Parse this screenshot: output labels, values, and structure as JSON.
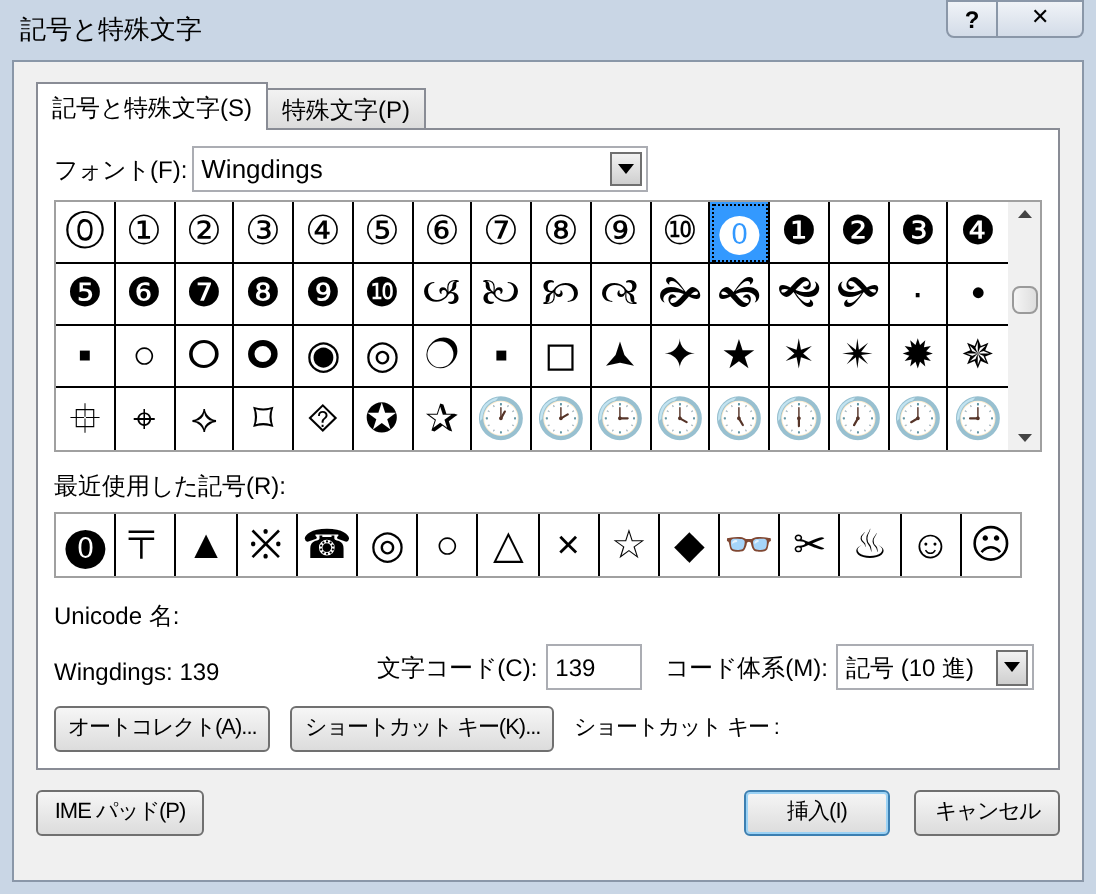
{
  "window": {
    "title": "記号と特殊文字",
    "help": "?",
    "close": "✕"
  },
  "tabs": [
    {
      "label": "記号と特殊文字(S)",
      "selected": true
    },
    {
      "label": "特殊文字(P)",
      "selected": false
    }
  ],
  "font": {
    "label": "フォント(F):",
    "value": "Wingdings"
  },
  "symbols": [
    {
      "glyph": "⓪",
      "selected": false
    },
    {
      "glyph": "①",
      "selected": false
    },
    {
      "glyph": "②",
      "selected": false
    },
    {
      "glyph": "③",
      "selected": false
    },
    {
      "glyph": "④",
      "selected": false
    },
    {
      "glyph": "⑤",
      "selected": false
    },
    {
      "glyph": "⑥",
      "selected": false
    },
    {
      "glyph": "⑦",
      "selected": false
    },
    {
      "glyph": "⑧",
      "selected": false
    },
    {
      "glyph": "⑨",
      "selected": false
    },
    {
      "glyph": "⑩",
      "selected": false
    },
    {
      "glyph": "⓿",
      "selected": true
    },
    {
      "glyph": "❶",
      "selected": false
    },
    {
      "glyph": "❷",
      "selected": false
    },
    {
      "glyph": "❸",
      "selected": false
    },
    {
      "glyph": "❹",
      "selected": false
    },
    {
      "glyph": "❺",
      "selected": false
    },
    {
      "glyph": "❻",
      "selected": false
    },
    {
      "glyph": "❼",
      "selected": false
    },
    {
      "glyph": "❽",
      "selected": false
    },
    {
      "glyph": "❾",
      "selected": false
    },
    {
      "glyph": "❿",
      "selected": false
    },
    {
      "glyph": "🙢",
      "selected": false
    },
    {
      "glyph": "🙠",
      "selected": false
    },
    {
      "glyph": "🙡",
      "selected": false
    },
    {
      "glyph": "🙣",
      "selected": false
    },
    {
      "glyph": "🙞",
      "selected": false
    },
    {
      "glyph": "🙜",
      "selected": false
    },
    {
      "glyph": "🙝",
      "selected": false
    },
    {
      "glyph": "🙟",
      "selected": false
    },
    {
      "glyph": "·",
      "selected": false
    },
    {
      "glyph": "•",
      "selected": false
    },
    {
      "glyph": "▪",
      "selected": false
    },
    {
      "glyph": "○",
      "selected": false
    },
    {
      "glyph": "🞆",
      "selected": false
    },
    {
      "glyph": "🞈",
      "selected": false
    },
    {
      "glyph": "◉",
      "selected": false
    },
    {
      "glyph": "◎",
      "selected": false
    },
    {
      "glyph": "🔿",
      "selected": false
    },
    {
      "glyph": "▪",
      "selected": false
    },
    {
      "glyph": "◻",
      "selected": false
    },
    {
      "glyph": "🟂",
      "selected": false
    },
    {
      "glyph": "✦",
      "selected": false
    },
    {
      "glyph": "★",
      "selected": false
    },
    {
      "glyph": "✶",
      "selected": false
    },
    {
      "glyph": "✴",
      "selected": false
    },
    {
      "glyph": "✹",
      "selected": false
    },
    {
      "glyph": "✵",
      "selected": false
    },
    {
      "glyph": "⯐",
      "selected": false
    },
    {
      "glyph": "⌖",
      "selected": false
    },
    {
      "glyph": "⟡",
      "selected": false
    },
    {
      "glyph": "⌑",
      "selected": false
    },
    {
      "glyph": "⯑",
      "selected": false
    },
    {
      "glyph": "✪",
      "selected": false
    },
    {
      "glyph": "✰",
      "selected": false
    },
    {
      "glyph": "🕐",
      "selected": false
    },
    {
      "glyph": "🕑",
      "selected": false
    },
    {
      "glyph": "🕒",
      "selected": false
    },
    {
      "glyph": "🕓",
      "selected": false
    },
    {
      "glyph": "🕔",
      "selected": false
    },
    {
      "glyph": "🕕",
      "selected": false
    },
    {
      "glyph": "🕖",
      "selected": false
    },
    {
      "glyph": "🕗",
      "selected": false
    },
    {
      "glyph": "🕘",
      "selected": false
    }
  ],
  "recent": {
    "label": "最近使用した記号(R):",
    "symbols": [
      "⓿",
      "〒",
      "▲",
      "※",
      "☎",
      "◎",
      "○",
      "△",
      "×",
      "☆",
      "◆",
      "👓",
      "✂",
      "♨",
      "☺",
      "☹"
    ]
  },
  "unicode_name": {
    "label": "Unicode 名:",
    "value": "Wingdings: 139"
  },
  "char_code": {
    "label": "文字コード(C):",
    "value": "139"
  },
  "code_system": {
    "label": "コード体系(M):",
    "value": "記号 (10 進)"
  },
  "buttons": {
    "autocorrect": "オートコレクト(A)...",
    "shortcut": "ショートカット キー(K)...",
    "shortcut_label": "ショートカット キー :",
    "ime": "IME パッド(P)",
    "insert": "挿入(I)",
    "cancel": "キャンセル"
  }
}
